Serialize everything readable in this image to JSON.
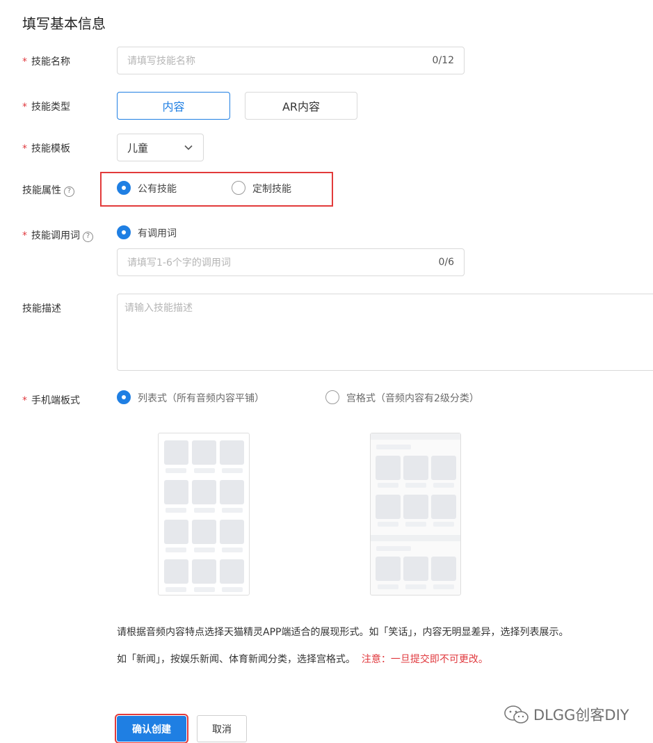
{
  "title": "填写基本信息",
  "fields": {
    "name": {
      "label": "技能名称",
      "placeholder": "请填写技能名称",
      "counter": "0/12"
    },
    "type": {
      "label": "技能类型",
      "options": [
        "内容",
        "AR内容"
      ],
      "selected": "内容"
    },
    "template": {
      "label": "技能模板",
      "value": "儿童"
    },
    "attribute": {
      "label": "技能属性",
      "help": "?",
      "options": [
        "公有技能",
        "定制技能"
      ],
      "selected": "公有技能"
    },
    "invocation": {
      "label": "技能调用词",
      "help": "?",
      "option": "有调用词",
      "placeholder": "请填写1-6个字的调用词",
      "counter": "0/6"
    },
    "description": {
      "label": "技能描述",
      "placeholder": "请输入技能描述"
    },
    "layout": {
      "label": "手机端板式",
      "options": [
        "列表式（所有音频内容平铺）",
        "宫格式（音频内容有2级分类）"
      ],
      "selected": "列表式（所有音频内容平铺）"
    }
  },
  "required_mark": "*",
  "notes": {
    "line1": "请根据音频内容特点选择天猫精灵APP端适合的展现形式。如「笑话」，内容无明显差异，选择列表展示。",
    "line2": "如「新闻」，按娱乐新闻、体育新闻分类，选择宫格式。",
    "warning": "注意：一旦提交即不可更改。"
  },
  "buttons": {
    "confirm": "确认创建",
    "cancel": "取消"
  },
  "watermark": "DLGG创客DIY",
  "colors": {
    "accent": "#1f7fe3",
    "required": "#e0393e",
    "highlight": "#e23a3a"
  },
  "icons": {
    "help": "question-circle-icon",
    "dropdown": "chevron-down-icon",
    "watermark": "wechat-icon"
  }
}
